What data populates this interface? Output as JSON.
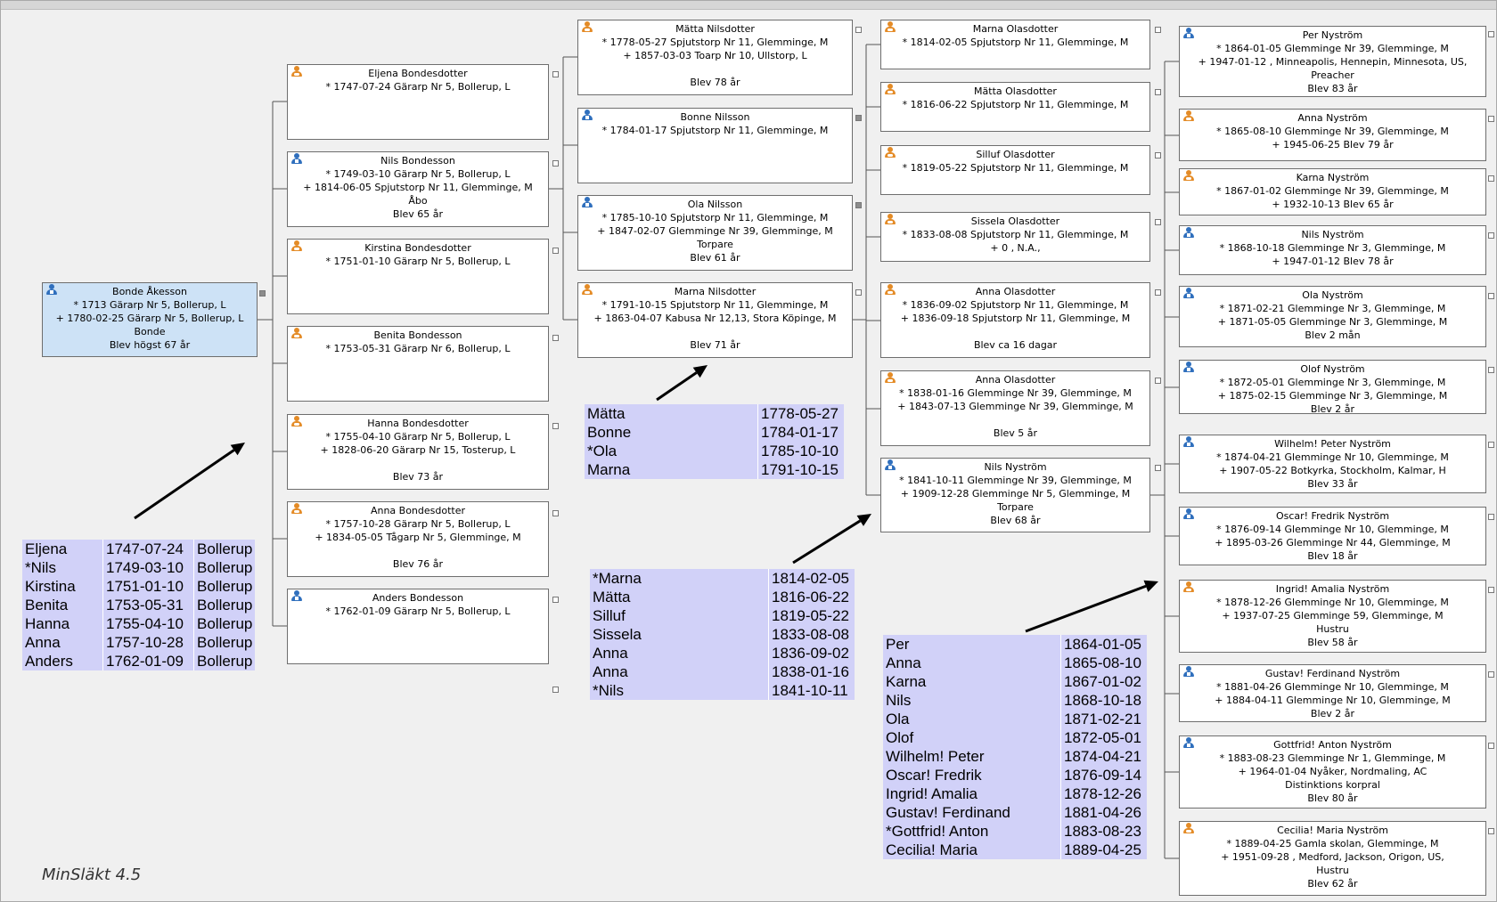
{
  "brand": "MinSläkt 4.5",
  "root": {
    "sex": "m",
    "name": "Bonde Åkesson",
    "lines": [
      "* 1713 Gärarp Nr 5, Bollerup, L",
      "+ 1780-02-25 Gärarp Nr 5, Bollerup, L",
      "Bonde",
      "Blev högst 67 år"
    ]
  },
  "gen1": [
    {
      "sex": "f",
      "name": "Eljena Bondesdotter",
      "lines": [
        "* 1747-07-24 Gärarp Nr 5, Bollerup, L"
      ]
    },
    {
      "sex": "m",
      "name": "Nils Bondesson",
      "lines": [
        "* 1749-03-10 Gärarp Nr 5, Bollerup, L",
        "+ 1814-06-05 Spjutstorp Nr 11, Glemminge, M",
        "Åbo",
        "Blev 65 år"
      ]
    },
    {
      "sex": "f",
      "name": "Kirstina Bondesdotter",
      "lines": [
        "* 1751-01-10 Gärarp Nr 5, Bollerup, L"
      ]
    },
    {
      "sex": "f",
      "name": "Benita Bondesson",
      "lines": [
        "* 1753-05-31 Gärarp Nr 6, Bollerup, L"
      ]
    },
    {
      "sex": "f",
      "name": "Hanna Bondesdotter",
      "lines": [
        "* 1755-04-10 Gärarp Nr 5, Bollerup, L",
        "+ 1828-06-20 Gärarp Nr 15, Tosterup, L",
        "",
        "Blev 73 år"
      ]
    },
    {
      "sex": "f",
      "name": "Anna Bondesdotter",
      "lines": [
        "* 1757-10-28 Gärarp Nr 5, Bollerup, L",
        "+ 1834-05-05 Tågarp Nr 5, Glemminge, M",
        "",
        "Blev 76 år"
      ]
    },
    {
      "sex": "m",
      "name": "Anders Bondesson",
      "lines": [
        "* 1762-01-09 Gärarp Nr 5, Bollerup, L"
      ]
    }
  ],
  "gen2": [
    {
      "sex": "f",
      "name": "Mätta Nilsdotter",
      "lines": [
        "* 1778-05-27 Spjutstorp Nr 11, Glemminge, M",
        "+ 1857-03-03 Toarp Nr 10, Ullstorp, L",
        "",
        "Blev 78 år"
      ]
    },
    {
      "sex": "m",
      "name": "Bonne Nilsson",
      "lines": [
        "* 1784-01-17 Spjutstorp Nr 11, Glemminge, M"
      ]
    },
    {
      "sex": "m",
      "name": "Ola Nilsson",
      "lines": [
        "* 1785-10-10 Spjutstorp Nr 11, Glemminge, M",
        "+ 1847-02-07 Glemminge Nr 39, Glemminge, M",
        "Torpare",
        "Blev 61 år"
      ]
    },
    {
      "sex": "f",
      "name": "Marna Nilsdotter",
      "lines": [
        "* 1791-10-15 Spjutstorp Nr 11, Glemminge, M",
        "+ 1863-04-07 Kabusa Nr 12,13, Stora Köpinge, M",
        "",
        "Blev 71 år"
      ]
    }
  ],
  "gen3": [
    {
      "sex": "f",
      "name": "Marna Olasdotter",
      "lines": [
        "* 1814-02-05 Spjutstorp Nr 11, Glemminge, M"
      ]
    },
    {
      "sex": "f",
      "name": "Mätta Olasdotter",
      "lines": [
        "* 1816-06-22 Spjutstorp Nr 11, Glemminge, M"
      ]
    },
    {
      "sex": "f",
      "name": "Silluf Olasdotter",
      "lines": [
        "* 1819-05-22 Spjutstorp Nr 11, Glemminge, M"
      ]
    },
    {
      "sex": "f",
      "name": "Sissela Olasdotter",
      "lines": [
        "* 1833-08-08 Spjutstorp Nr 11, Glemminge, M",
        "+ 0 , N.A.,"
      ]
    },
    {
      "sex": "f",
      "name": "Anna Olasdotter",
      "lines": [
        "* 1836-09-02 Spjutstorp Nr 11, Glemminge, M",
        "+ 1836-09-18 Spjutstorp Nr 11, Glemminge, M",
        "",
        "Blev ca 16 dagar"
      ]
    },
    {
      "sex": "f",
      "name": "Anna Olasdotter",
      "lines": [
        "* 1838-01-16 Glemminge Nr 39, Glemminge, M",
        "+ 1843-07-13 Glemminge Nr 39, Glemminge, M",
        "",
        "Blev 5 år"
      ]
    },
    {
      "sex": "m",
      "name": "Nils Nyström",
      "lines": [
        "* 1841-10-11 Glemminge Nr 39, Glemminge, M",
        "+ 1909-12-28 Glemminge Nr 5, Glemminge, M",
        "Torpare",
        "Blev 68 år"
      ]
    }
  ],
  "gen4": [
    {
      "sex": "m",
      "name": "Per Nyström",
      "lines": [
        "* 1864-01-05 Glemminge Nr 39, Glemminge, M",
        "+ 1947-01-12 , Minneapolis, Hennepin, Minnesota, US,",
        "Preacher",
        "Blev 83 år"
      ]
    },
    {
      "sex": "f",
      "name": "Anna Nyström",
      "lines": [
        "* 1865-08-10 Glemminge Nr 39, Glemminge, M",
        "+ 1945-06-25          Blev 79 år"
      ]
    },
    {
      "sex": "f",
      "name": "Karna Nyström",
      "lines": [
        "* 1867-01-02 Glemminge Nr 39, Glemminge, M",
        "+ 1932-10-13          Blev 65 år"
      ]
    },
    {
      "sex": "m",
      "name": "Nils Nyström",
      "lines": [
        "* 1868-10-18 Glemminge Nr 3, Glemminge, M",
        "+ 1947-01-12          Blev 78 år"
      ]
    },
    {
      "sex": "m",
      "name": "Ola Nyström",
      "lines": [
        "* 1871-02-21 Glemminge Nr 3, Glemminge, M",
        "+ 1871-05-05 Glemminge Nr 3, Glemminge, M",
        "Blev 2 mån"
      ]
    },
    {
      "sex": "m",
      "name": "Olof Nyström",
      "lines": [
        "* 1872-05-01 Glemminge Nr 3, Glemminge, M",
        "+ 1875-02-15 Glemminge Nr 3, Glemminge, M",
        "Blev 2 år"
      ]
    },
    {
      "sex": "m",
      "name": "Wilhelm! Peter Nyström",
      "lines": [
        "* 1874-04-21 Glemminge Nr 10, Glemminge, M",
        "+ 1907-05-22 Botkyrka, Stockholm, Kalmar, H",
        "Blev 33 år"
      ]
    },
    {
      "sex": "m",
      "name": "Oscar! Fredrik Nyström",
      "lines": [
        "* 1876-09-14 Glemminge Nr 10, Glemminge, M",
        "+ 1895-03-26 Glemminge Nr 44, Glemminge, M",
        "Blev 18 år"
      ]
    },
    {
      "sex": "f",
      "name": "Ingrid! Amalia Nyström",
      "lines": [
        "* 1878-12-26 Glemminge Nr 10, Glemminge, M",
        "+ 1937-07-25 Glemminge 59, Glemminge, M",
        "Hustru",
        "Blev 58 år"
      ]
    },
    {
      "sex": "m",
      "name": "Gustav! Ferdinand Nyström",
      "lines": [
        "* 1881-04-26 Glemminge Nr 10, Glemminge, M",
        "+ 1884-04-11 Glemminge Nr 10, Glemminge, M",
        "Blev 2 år"
      ]
    },
    {
      "sex": "m",
      "name": "Gottfrid! Anton Nyström",
      "lines": [
        "* 1883-08-23 Glemminge Nr 1, Glemminge, M",
        "+ 1964-01-04 Nyåker, Nordmaling, AC",
        "Distinktions korpral",
        "Blev 80 år"
      ]
    },
    {
      "sex": "f",
      "name": "Cecilia! Maria Nyström",
      "lines": [
        "* 1889-04-25 Gamla skolan, Glemminge, M",
        "+ 1951-09-28 , Medford, Jackson, Origon, US,",
        "Hustru",
        "Blev 62 år"
      ]
    }
  ],
  "summaries": [
    {
      "rows": [
        [
          "Eljena",
          "1747-07-24",
          "Bollerup"
        ],
        [
          "*Nils",
          "1749-03-10",
          "Bollerup"
        ],
        [
          "Kirstina",
          "1751-01-10",
          "Bollerup"
        ],
        [
          "Benita",
          "1753-05-31",
          "Bollerup"
        ],
        [
          "Hanna",
          "1755-04-10",
          "Bollerup"
        ],
        [
          "Anna",
          "1757-10-28",
          "Bollerup"
        ],
        [
          "Anders",
          "1762-01-09",
          "Bollerup"
        ]
      ]
    },
    {
      "rows": [
        [
          "Mätta",
          "1778-05-27"
        ],
        [
          "Bonne",
          "1784-01-17"
        ],
        [
          "*Ola",
          "1785-10-10"
        ],
        [
          "Marna",
          "1791-10-15"
        ]
      ]
    },
    {
      "rows": [
        [
          "*Marna",
          "1814-02-05"
        ],
        [
          "Mätta",
          "1816-06-22"
        ],
        [
          "Silluf",
          "1819-05-22"
        ],
        [
          "Sissela",
          "1833-08-08"
        ],
        [
          "Anna",
          "1836-09-02"
        ],
        [
          "Anna",
          "1838-01-16"
        ],
        [
          "*Nils",
          "1841-10-11"
        ]
      ]
    },
    {
      "rows": [
        [
          "Per",
          "1864-01-05"
        ],
        [
          "Anna",
          "1865-08-10"
        ],
        [
          "Karna",
          "1867-01-02"
        ],
        [
          "Nils",
          "1868-10-18"
        ],
        [
          "Ola",
          "1871-02-21"
        ],
        [
          "Olof",
          "1872-05-01"
        ],
        [
          "Wilhelm! Peter",
          "1874-04-21"
        ],
        [
          "Oscar! Fredrik",
          "1876-09-14"
        ],
        [
          "Ingrid! Amalia",
          "1878-12-26"
        ],
        [
          "Gustav! Ferdinand",
          "1881-04-26"
        ],
        [
          "*Gottfrid! Anton",
          "1883-08-23"
        ],
        [
          "Cecilia! Maria",
          "1889-04-25"
        ]
      ]
    }
  ]
}
